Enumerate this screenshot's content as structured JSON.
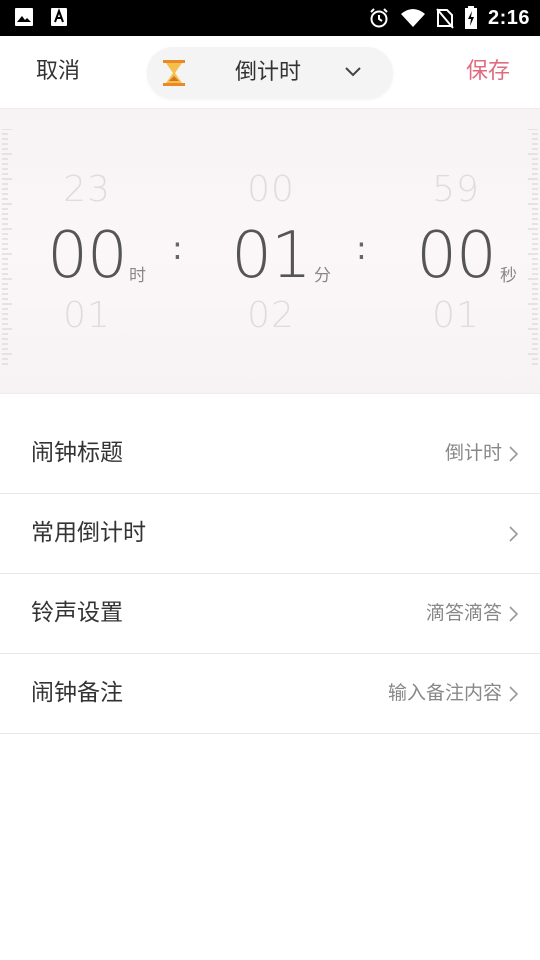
{
  "status_bar": {
    "time": "2:16",
    "icons": [
      "image-icon",
      "text-a-icon",
      "alarm-icon",
      "wifi-icon",
      "no-sim-icon",
      "battery-charging-icon"
    ]
  },
  "header": {
    "cancel_label": "取消",
    "mode_label": "倒计时",
    "save_label": "保存",
    "accent_color": "#e06b7e"
  },
  "picker": {
    "hours": {
      "prev": "23",
      "value": "00",
      "next": "01",
      "unit": "时"
    },
    "minutes": {
      "prev": "00",
      "value": "01",
      "next": "02",
      "unit": "分"
    },
    "seconds": {
      "prev": "59",
      "value": "00",
      "next": "01",
      "unit": "秒"
    },
    "separator": ":"
  },
  "settings": [
    {
      "label": "闹钟标题",
      "value": "倒计时"
    },
    {
      "label": "常用倒计时",
      "value": ""
    },
    {
      "label": "铃声设置",
      "value": "滴答滴答"
    },
    {
      "label": "闹钟备注",
      "value": "输入备注内容"
    }
  ]
}
